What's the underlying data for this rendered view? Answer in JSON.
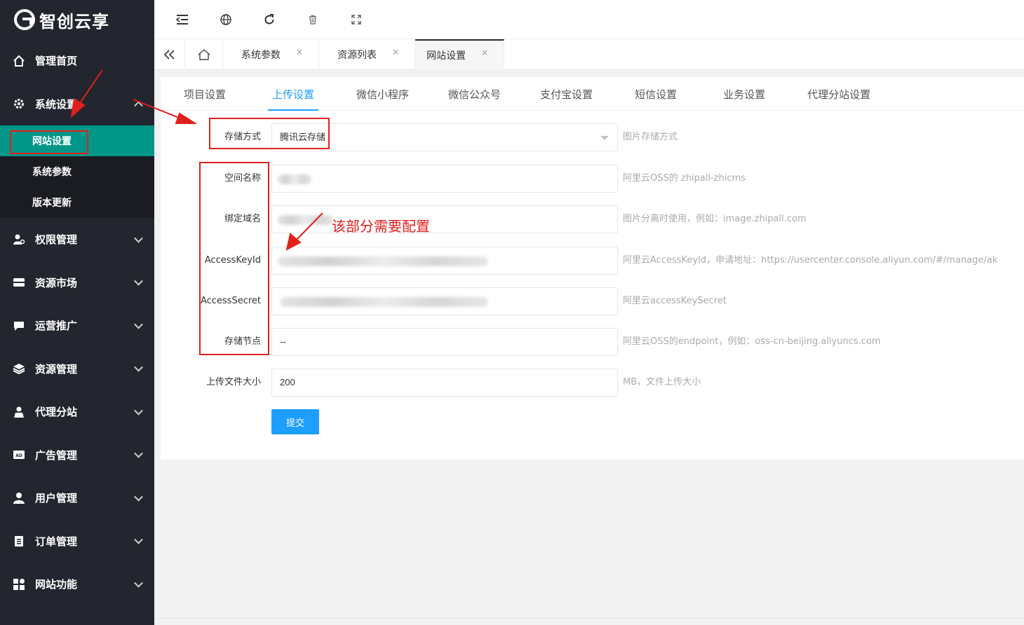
{
  "app": {
    "logo_text": "智创云享"
  },
  "sidebar": {
    "items": [
      {
        "label": "管理首页",
        "icon": "home-icon"
      },
      {
        "label": "系统设置",
        "icon": "gear-icon",
        "expanded": true,
        "children": [
          {
            "label": "网站设置",
            "active": true
          },
          {
            "label": "系统参数"
          },
          {
            "label": "版本更新"
          }
        ]
      },
      {
        "label": "权限管理",
        "icon": "user-key-icon"
      },
      {
        "label": "资源市场",
        "icon": "store-icon"
      },
      {
        "label": "运营推广",
        "icon": "flag-icon"
      },
      {
        "label": "资源管理",
        "icon": "layers-icon"
      },
      {
        "label": "代理分站",
        "icon": "agent-icon"
      },
      {
        "label": "广告管理",
        "icon": "ad-icon"
      },
      {
        "label": "用户管理",
        "icon": "user-icon"
      },
      {
        "label": "订单管理",
        "icon": "clipboard-icon"
      },
      {
        "label": "网站功能",
        "icon": "grid-icon"
      }
    ]
  },
  "topbar": {
    "icons": [
      "collapse-menu-icon",
      "globe-icon",
      "refresh-icon",
      "trash-icon",
      "fullscreen-icon"
    ]
  },
  "tabs": {
    "items": [
      {
        "label": "系统参数",
        "close": "×"
      },
      {
        "label": "资源列表",
        "close": "×"
      },
      {
        "label": "网站设置",
        "close": "×",
        "active": true
      }
    ]
  },
  "subtabs": {
    "items": [
      "项目设置",
      "上传设置",
      "微信小程序",
      "微信公众号",
      "支付宝设置",
      "短信设置",
      "业务设置",
      "代理分站设置"
    ],
    "active_index": 1
  },
  "form": {
    "storage": {
      "label": "存储方式",
      "value": "腾讯云存储",
      "hint": "图片存储方式"
    },
    "bucket": {
      "label": "空间名称",
      "value": "",
      "hint": "阿里云OSS的 zhipall-zhicms"
    },
    "domain": {
      "label": "绑定域名",
      "value": "",
      "hint": "图片分离时使用，例如：image.zhipall.com"
    },
    "access_key_id": {
      "label": "AccessKeyId",
      "value": "",
      "hint": "阿里云AccessKeyId，申请地址：https://usercenter.console.aliyun.com/#/manage/ak"
    },
    "access_secret": {
      "label": "AccessSecret",
      "value": "",
      "hint": "阿里云accessKeySecret"
    },
    "endpoint": {
      "label": "存储节点",
      "value": "--",
      "hint": "阿里云OSS的endpoint，例如：oss-cn-beijing.aliyuncs.com"
    },
    "upload_size": {
      "label": "上传文件大小",
      "value": "200",
      "hint": "MB，文件上传大小"
    },
    "submit_label": "提交"
  },
  "annotation": {
    "text": "该部分需要配置",
    "color": "#e0201c"
  },
  "colors": {
    "sidebar_bg": "#23262e",
    "active_green": "#009688",
    "accent_blue": "#1e9fff"
  }
}
